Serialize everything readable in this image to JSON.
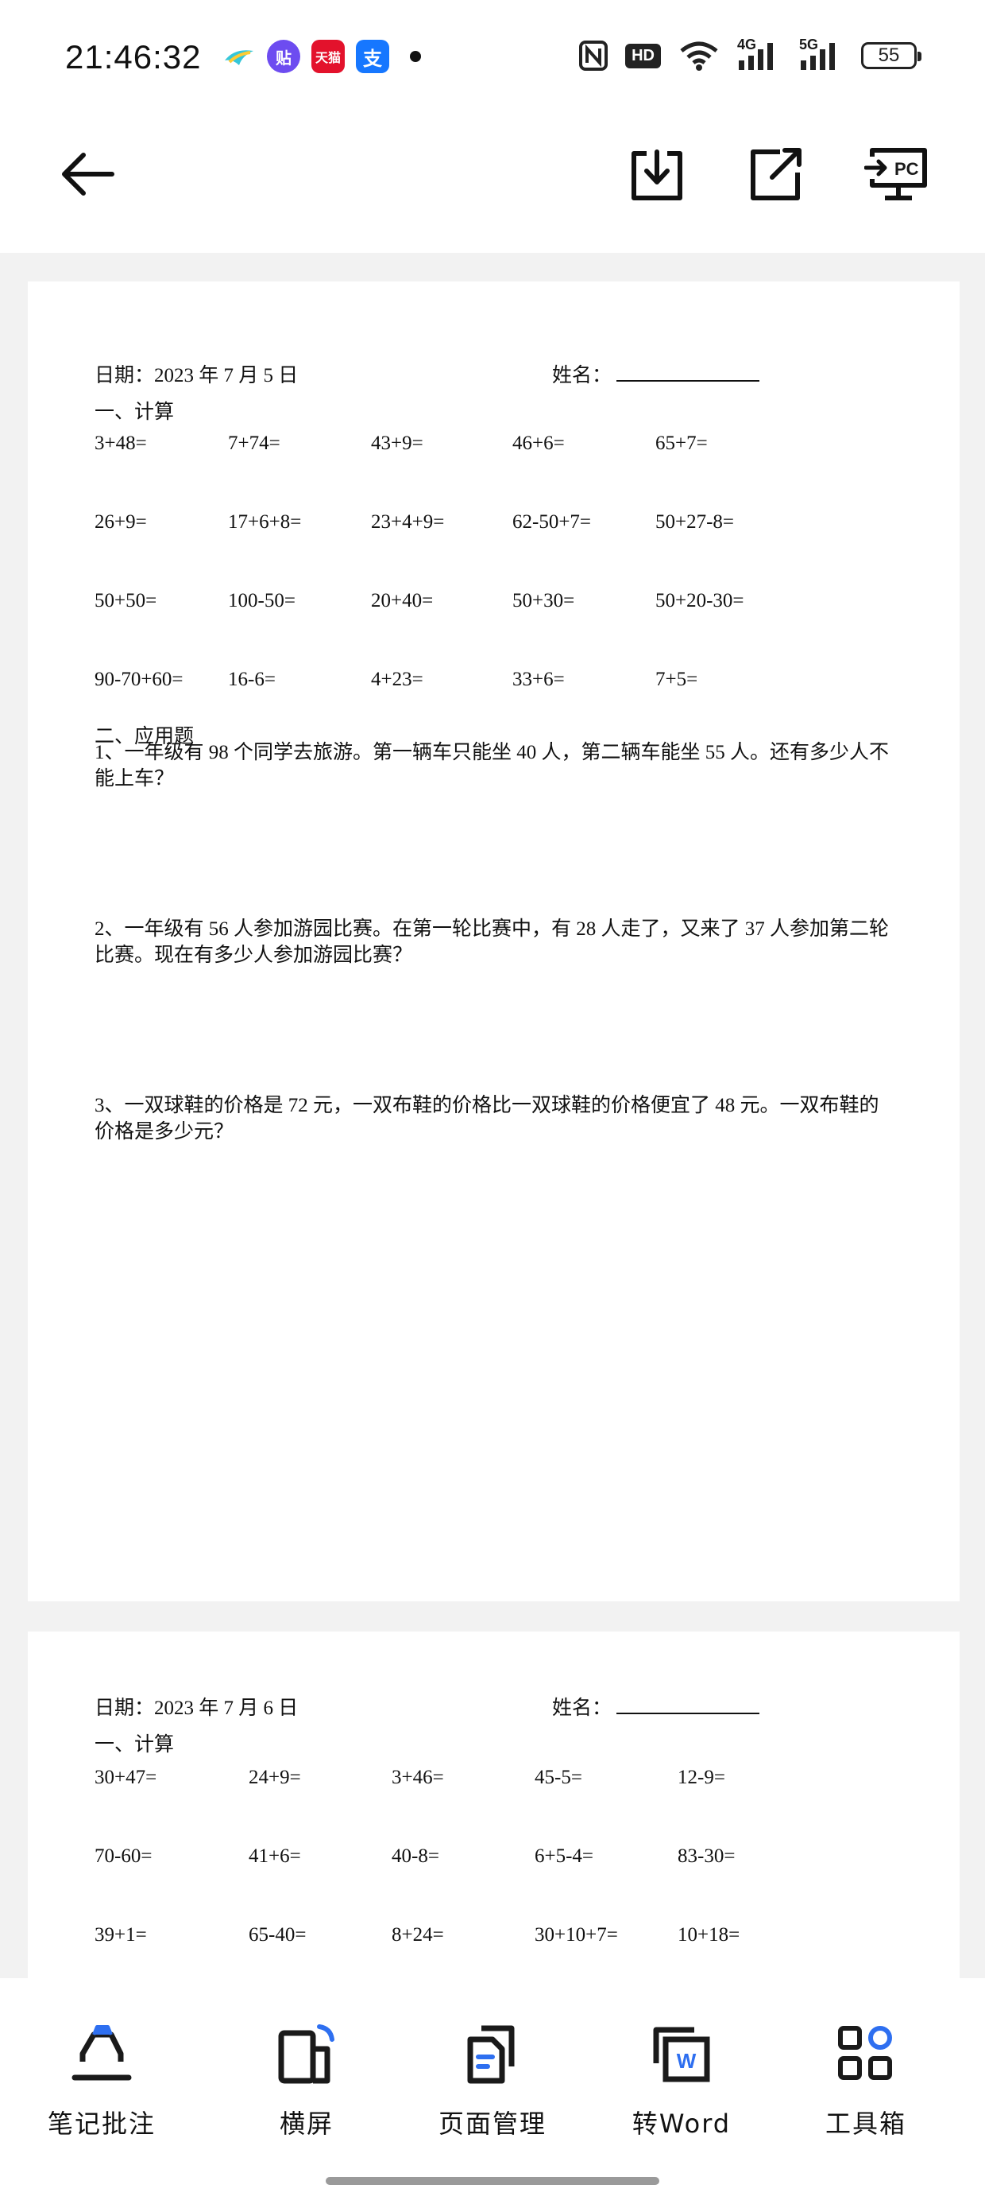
{
  "status_bar": {
    "time": "21:46:32",
    "apps": [
      {
        "icon": "bird-app-icon",
        "text": "",
        "color": "#3aa0ff"
      },
      {
        "icon": "tieba-app-icon",
        "text": "贴",
        "color": "#6d4cf0"
      },
      {
        "icon": "tmall-app-icon",
        "text": "天猫",
        "color": "#e3122c"
      },
      {
        "icon": "alipay-app-icon",
        "text": "支",
        "color": "#1677ff"
      }
    ],
    "battery_level": "55",
    "network_4g": "4G",
    "network_5g": "5G",
    "hd_label": "HD"
  },
  "toolbar": {
    "back": "back-arrow-icon",
    "download": "download-icon",
    "share": "share-icon",
    "pc": "PC"
  },
  "page1": {
    "date": "日期：2023 年 7 月 5 日",
    "name_label": "姓名：",
    "section1": "一、计算",
    "rows": [
      [
        "3+48=",
        "7+74=",
        "43+9=",
        "46+6=",
        "65+7="
      ],
      [
        "26+9=",
        "17+6+8=",
        "23+4+9=",
        "62-50+7=",
        "50+27-8="
      ],
      [
        "50+50=",
        "100-50=",
        "20+40=",
        "50+30=",
        "50+20-30="
      ],
      [
        "90-70+60=",
        "16-6=",
        "4+23=",
        "33+6=",
        "7+5="
      ]
    ],
    "section2": "二、应用题",
    "problems": [
      "1、一年级有 98 个同学去旅游。第一辆车只能坐 40 人，第二辆车能坐 55 人。还有多少人不能上车？",
      "2、一年级有 56 人参加游园比赛。在第一轮比赛中，有 28 人走了，又来了 37 人参加第二轮比赛。现在有多少人参加游园比赛？",
      "3、一双球鞋的价格是 72 元，一双布鞋的价格比一双球鞋的价格便宜了 48 元。一双布鞋的价格是多少元？"
    ]
  },
  "page2": {
    "date": "日期：2023 年 7 月 6 日",
    "name_label": "姓名：",
    "section1": "一、计算",
    "rows": [
      [
        "30+47=",
        "24+9=",
        "3+46=",
        "45-5=",
        "12-9="
      ],
      [
        "70-60=",
        "41+6=",
        "40-8=",
        "6+5-4=",
        "83-30="
      ],
      [
        "39+1=",
        "65-40=",
        "8+24=",
        "30+10+7=",
        "10+18="
      ]
    ]
  },
  "bottom_nav": [
    {
      "label": "笔记批注",
      "icon": "annotate-pen-icon"
    },
    {
      "label": "横屏",
      "icon": "rotate-screen-icon"
    },
    {
      "label": "页面管理",
      "icon": "page-manage-icon"
    },
    {
      "label": "转Word",
      "icon": "convert-word-icon"
    },
    {
      "label": "工具箱",
      "icon": "toolbox-icon"
    }
  ],
  "colors": {
    "accent": "#2e6ff0",
    "viewer_bg": "#f2f2f2"
  }
}
